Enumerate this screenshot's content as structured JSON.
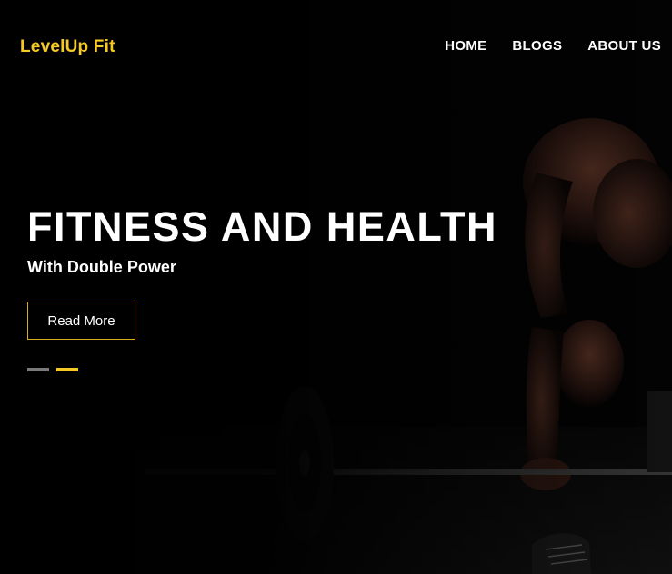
{
  "brand": {
    "name": "LevelUp Fit"
  },
  "nav": {
    "items": [
      {
        "label": "HOME"
      },
      {
        "label": "BLOGS"
      },
      {
        "label": "ABOUT US"
      }
    ]
  },
  "hero": {
    "headline": "FITNESS AND HEALTH",
    "subheadline": "With Double Power",
    "cta_label": "Read More",
    "slides_total": 2,
    "active_slide": 2
  },
  "colors": {
    "accent": "#f7c924",
    "background": "#030303",
    "text": "#ffffff",
    "indicator_inactive": "#7a7a7a"
  }
}
